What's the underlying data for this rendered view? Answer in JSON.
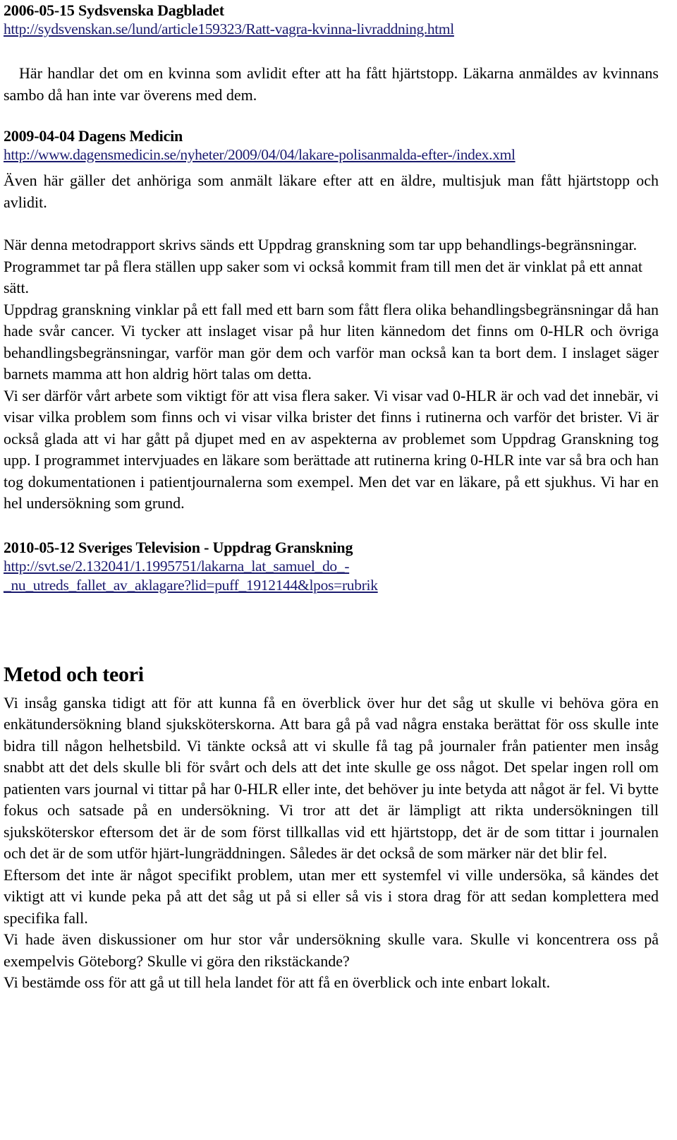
{
  "document": {
    "sources": [
      {
        "heading": "2006-05-15 Sydsvenska Dagbladet",
        "url": "http://sydsvenskan.se/lund/article159323/Ratt-vagra-kvinna-livraddning.html",
        "summary": "Här handlar det om en kvinna som avlidit efter att ha fått hjärtstopp. Läkarna anmäldes av kvinnans sambo då han inte var överens med dem."
      },
      {
        "heading": "2009-04-04 Dagens Medicin",
        "url": "http://www.dagensmedicin.se/nyheter/2009/04/04/lakare-polisanmalda-efter-/index.xml",
        "summary": "Även här gäller det anhöriga som anmält läkare efter att en äldre, multisjuk man fått hjärtstopp och avlidit."
      },
      {
        "heading": "2010-05-12 Sveriges Television - Uppdrag Granskning",
        "url_line1": "http://svt.se/2.132041/1.1995751/lakarna_lat_samuel_do_-",
        "url_line2": "_nu_utreds_fallet_av_aklagare?lid=puff_1912144&lpos=rubrik"
      }
    ],
    "commentary": {
      "para1": "När denna metodrapport skrivs sänds ett Uppdrag granskning som tar upp behandlings-begränsningar. Programmet tar på flera ställen upp saker som vi också kommit fram till men det är vinklat på ett annat sätt.",
      "para2": "Uppdrag granskning vinklar på ett fall med ett barn som fått flera olika behandlingsbegränsningar då han hade svår cancer. Vi tycker att inslaget visar på hur liten kännedom det finns om 0-HLR och övriga behandlingsbegränsningar, varför man gör dem och varför man också kan ta bort dem. I inslaget säger barnets mamma att hon aldrig hört talas om detta.",
      "para3": "Vi ser därför vårt arbete som viktigt för att visa flera saker. Vi visar vad 0-HLR är och vad det innebär, vi visar vilka problem som finns och vi visar vilka brister det finns i rutinerna och varför det brister. Vi är också glada att vi har gått på djupet med en av aspekterna av problemet som Uppdrag Granskning tog upp. I programmet intervjuades en läkare som berättade att rutinerna kring 0-HLR inte var så bra och han tog dokumentationen i patientjournalerna som exempel. Men det var en läkare, på ett sjukhus. Vi har en hel undersökning som grund."
    },
    "method": {
      "heading": "Metod och teori",
      "para1": "Vi insåg ganska tidigt att för att kunna få en överblick över hur det såg ut skulle vi behöva göra en enkätundersökning bland sjuksköterskorna. Att bara gå på vad några enstaka berättat för oss skulle inte bidra till någon helhetsbild. Vi tänkte också att vi skulle få tag på journaler från patienter men insåg snabbt att det dels skulle bli för svårt och dels att det inte skulle ge oss något. Det spelar ingen roll om patienten vars journal vi tittar på har 0-HLR eller inte, det behöver ju inte betyda att något är fel. Vi bytte fokus och satsade på en undersökning. Vi tror att det är lämpligt att rikta undersökningen till sjuksköterskor eftersom det är de som först tillkallas vid ett hjärtstopp, det är de som tittar i journalen och det är de som utför hjärt-lungräddningen. Således är det också de som märker när det blir fel.",
      "para2": "Eftersom det inte är något specifikt problem, utan mer ett systemfel vi ville undersöka, så kändes det viktigt att vi kunde peka på att det såg ut på si eller så vis i stora drag för att sedan komplettera med specifika fall.",
      "para3": "Vi hade även diskussioner om hur stor vår undersökning skulle vara. Skulle vi koncentrera oss på exempelvis Göteborg? Skulle vi göra den rikstäckande?",
      "para4": "Vi bestämde oss för att gå ut till hela landet för att få en överblick och inte enbart lokalt."
    }
  },
  "colors": {
    "link": "#1b1b6f",
    "text": "#000000",
    "background": "#ffffff"
  }
}
